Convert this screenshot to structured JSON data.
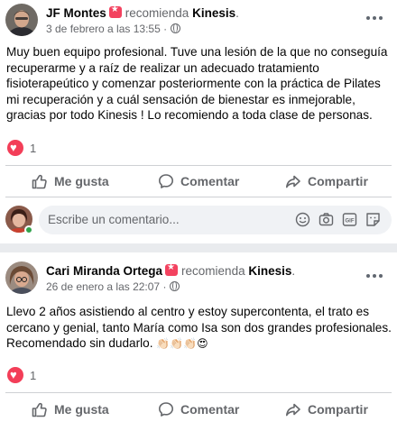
{
  "posts": [
    {
      "author": "JF Montes",
      "recommends": "recomienda",
      "page": "Kinesis",
      "date": "3 de febrero a las 13:55",
      "dot": "·",
      "text": "Muy buen equipo profesional. Tuve una lesión de la que no conseguía recuperarme y a raíz de realizar un adecuado tratamiento fisioterapeútico y comenzar posteriormente con la práctica de Pilates mi recuperación y a cuál sensación de bienestar es inmejorable, gracias por todo Kinesis ! Lo recomiendo a toda clase de personas.",
      "reaction_count": "1",
      "like_label": "Me gusta",
      "comment_label": "Comentar",
      "share_label": "Compartir"
    },
    {
      "author": "Cari Miranda Ortega",
      "recommends": "recomienda",
      "page": "Kinesis",
      "date": "26 de enero a las 22:07",
      "dot": "·",
      "text": "Llevo 2 años asistiendo al centro y estoy supercontenta, el trato es cercano y  genial, tanto María como Isa son dos grandes profesionales. Recomendado sin dudarlo.",
      "emojis": "👏🏻👏🏻👏🏻😍",
      "reaction_count": "1",
      "like_label": "Me gusta",
      "comment_label": "Comentar",
      "share_label": "Compartir"
    }
  ],
  "comment_box": {
    "placeholder": "Escribe un comentario..."
  },
  "icons": [
    "recommend-star-icon",
    "globe-icon",
    "more-options-icon",
    "heart-reaction-icon",
    "like-icon",
    "comment-icon",
    "share-icon",
    "emoji-icon",
    "camera-icon",
    "gif-icon",
    "sticker-icon"
  ],
  "colors": {
    "recommend": "#f3425f",
    "heart": "#f33e58",
    "muted": "#65676b",
    "online": "#31a24c"
  }
}
